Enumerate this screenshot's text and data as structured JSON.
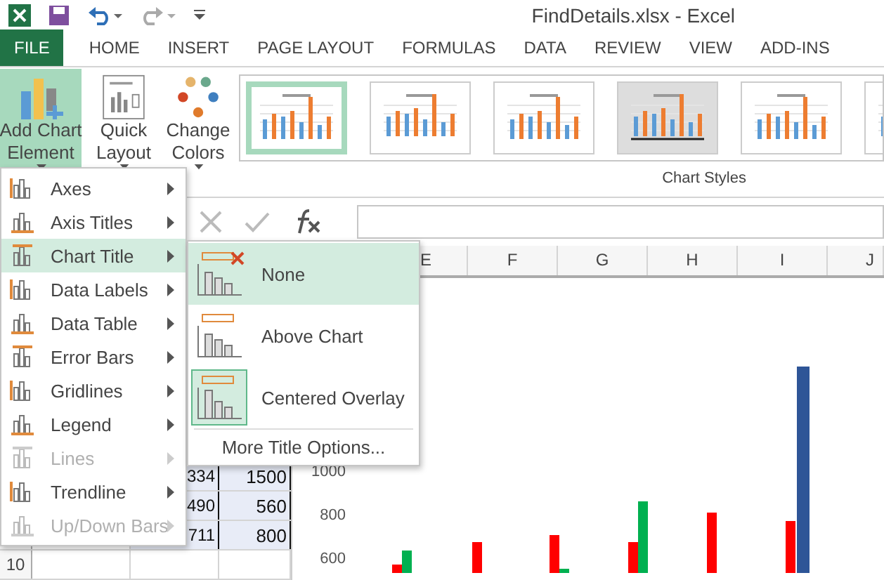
{
  "window": {
    "title": "FindDetails.xlsx - Excel"
  },
  "tabs": [
    {
      "label": "FILE",
      "kind": "file",
      "selected": false
    },
    {
      "label": "HOME",
      "kind": "tab",
      "selected": false
    },
    {
      "label": "INSERT",
      "kind": "tab",
      "selected": false
    },
    {
      "label": "PAGE LAYOUT",
      "kind": "tab",
      "selected": false
    },
    {
      "label": "FORMULAS",
      "kind": "tab",
      "selected": false
    },
    {
      "label": "DATA",
      "kind": "tab",
      "selected": false
    },
    {
      "label": "REVIEW",
      "kind": "tab",
      "selected": false
    },
    {
      "label": "VIEW",
      "kind": "tab",
      "selected": false
    },
    {
      "label": "ADD-INS",
      "kind": "tab",
      "selected": false
    }
  ],
  "ribbon": {
    "buttons": [
      {
        "lines": [
          "Add Chart",
          "Element"
        ],
        "kind": "add",
        "selected": true
      },
      {
        "lines": [
          "Quick",
          "Layout"
        ],
        "kind": "layout",
        "selected": false
      },
      {
        "lines": [
          "Change",
          "Colors"
        ],
        "kind": "colors",
        "selected": false
      }
    ],
    "styles": [
      {
        "selected": true
      },
      {
        "selected": false
      },
      {
        "selected": false
      },
      {
        "selected": false
      },
      {
        "selected": false
      },
      {
        "selected": false
      }
    ],
    "group_label": "Chart Styles"
  },
  "columns": [
    "E",
    "F",
    "G",
    "H",
    "I",
    "J"
  ],
  "rows": [
    {
      "cells": [
        "334",
        "1500"
      ]
    },
    {
      "cells": [
        "490",
        "560"
      ]
    },
    {
      "cells": [
        "711",
        "800"
      ]
    }
  ],
  "row_header": "10",
  "chart": {
    "axis_labels": [
      "1000",
      "800",
      "600"
    ]
  },
  "menu": {
    "items": [
      {
        "label": "Axes",
        "disabled": false,
        "selected": false
      },
      {
        "label": "Axis Titles",
        "disabled": false,
        "selected": false
      },
      {
        "label": "Chart Title",
        "disabled": false,
        "selected": true
      },
      {
        "label": "Data Labels",
        "disabled": false,
        "selected": false
      },
      {
        "label": "Data Table",
        "disabled": false,
        "selected": false
      },
      {
        "label": "Error Bars",
        "disabled": false,
        "selected": false
      },
      {
        "label": "Gridlines",
        "disabled": false,
        "selected": false
      },
      {
        "label": "Legend",
        "disabled": false,
        "selected": false
      },
      {
        "label": "Lines",
        "disabled": true,
        "selected": false
      },
      {
        "label": "Trendline",
        "disabled": false,
        "selected": false
      },
      {
        "label": "Up/Down Bars",
        "disabled": true,
        "selected": false
      }
    ]
  },
  "submenu": {
    "options": [
      {
        "label": "None",
        "kind": "none",
        "selected": true,
        "current": false
      },
      {
        "label": "Above Chart",
        "kind": "above",
        "selected": false,
        "current": false
      },
      {
        "label": "Centered Overlay",
        "kind": "overlay",
        "selected": false,
        "current": true
      }
    ],
    "footer": "More Title Options..."
  }
}
